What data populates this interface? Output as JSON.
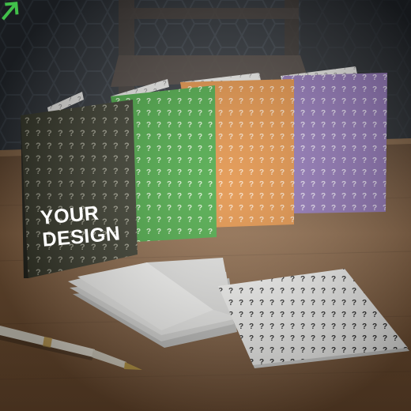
{
  "card_front": {
    "headline_line1": "YOUR",
    "headline_line2": "DESIGN",
    "pattern_glyph": "?"
  },
  "colors": {
    "card_dark": "#2f3122",
    "card_green": "#3fa33a",
    "card_orange": "#e08a3a",
    "card_purple": "#8c6fb4",
    "arrow_accent": "#41c04a",
    "table": "#7a5636",
    "wall": "#2a2f35"
  },
  "icons": {
    "arrow": "arrow-up-right-icon",
    "pen": "fountain-pen-icon"
  }
}
